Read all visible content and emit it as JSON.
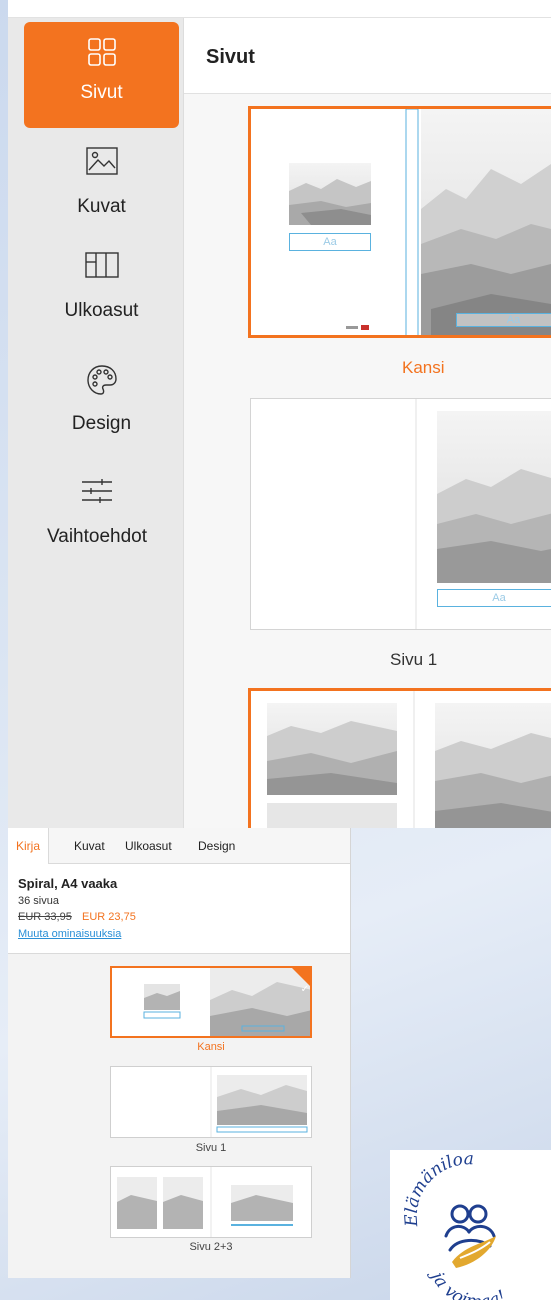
{
  "top_app": {
    "sidebar": {
      "items": [
        {
          "label": "Sivut",
          "icon": "pages-grid-icon",
          "active": true
        },
        {
          "label": "Kuvat",
          "icon": "image-icon",
          "active": false
        },
        {
          "label": "Ulkoasut",
          "icon": "layout-icon",
          "active": false
        },
        {
          "label": "Design",
          "icon": "palette-icon",
          "active": false
        },
        {
          "label": "Vaihtoehdot",
          "icon": "sliders-icon",
          "active": false
        }
      ]
    },
    "main": {
      "title": "Sivut",
      "spreads": [
        {
          "label": "Kansi",
          "selected": true,
          "text_placeholder": "Aa"
        },
        {
          "label": "Sivu 1",
          "selected": false,
          "text_placeholder": "Aa"
        },
        {
          "label": "",
          "selected": true
        }
      ]
    }
  },
  "bottom_app": {
    "tabs": [
      "Kirja",
      "Kuvat",
      "Ulkoasut",
      "Design"
    ],
    "product": {
      "name": "Spiral, A4 vaaka",
      "pages": "36 sivua",
      "old_price": "EUR 33,95",
      "new_price": "EUR 23,75",
      "link": "Muuta ominaisuuksia"
    },
    "thumbnails": [
      {
        "label": "Kansi",
        "selected": true
      },
      {
        "label": "Sivu 1",
        "selected": false
      },
      {
        "label": "Sivu 2+3",
        "selected": false
      }
    ]
  },
  "logo": {
    "text_top": "Elämäniloa",
    "text_bottom": "ja voimaa!"
  },
  "colors": {
    "accent": "#f3731f",
    "link": "#2a8fd6",
    "frame": "#5ab2df"
  }
}
